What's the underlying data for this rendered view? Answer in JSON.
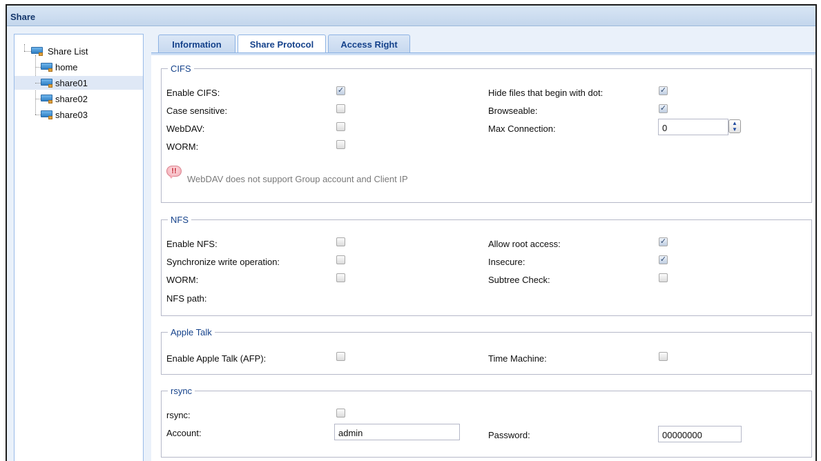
{
  "window": {
    "title": "Share"
  },
  "tree": {
    "root_label": "Share List",
    "items": [
      {
        "label": "home",
        "selected": false
      },
      {
        "label": "share01",
        "selected": true
      },
      {
        "label": "share02",
        "selected": false
      },
      {
        "label": "share03",
        "selected": false
      }
    ]
  },
  "tabs": [
    {
      "label": "Information",
      "active": false
    },
    {
      "label": "Share Protocol",
      "active": true
    },
    {
      "label": "Access Right",
      "active": false
    }
  ],
  "cifs": {
    "legend": "CIFS",
    "enable_cifs": {
      "label": "Enable CIFS:",
      "checked": true
    },
    "case_sensitive": {
      "label": "Case sensitive:",
      "checked": false
    },
    "webdav": {
      "label": "WebDAV:",
      "checked": false
    },
    "worm": {
      "label": "WORM:",
      "checked": false
    },
    "hide_dot": {
      "label": "Hide files that begin with dot:",
      "checked": true
    },
    "browseable": {
      "label": "Browseable:",
      "checked": true
    },
    "max_connection": {
      "label": "Max Connection:",
      "value": "0"
    },
    "note": "WebDAV does not support Group account and Client IP",
    "warn_icon_glyph": "!!"
  },
  "nfs": {
    "legend": "NFS",
    "enable_nfs": {
      "label": "Enable NFS:",
      "checked": false
    },
    "sync_write": {
      "label": "Synchronize write operation:",
      "checked": false
    },
    "worm": {
      "label": "WORM:",
      "checked": false
    },
    "nfs_path": {
      "label": "NFS path:"
    },
    "allow_root": {
      "label": "Allow root access:",
      "checked": true
    },
    "insecure": {
      "label": "Insecure:",
      "checked": true
    },
    "subtree_check": {
      "label": "Subtree Check:",
      "checked": false
    }
  },
  "appletalk": {
    "legend": "Apple Talk",
    "enable_afp": {
      "label": "Enable Apple Talk (AFP):",
      "checked": false
    },
    "time_machine": {
      "label": "Time Machine:",
      "checked": false
    }
  },
  "rsync": {
    "legend": "rsync",
    "rsync": {
      "label": "rsync:",
      "checked": false
    },
    "account": {
      "label": "Account:",
      "value": "admin"
    },
    "password": {
      "label": "Password:",
      "value": "00000000"
    }
  },
  "glyphs": {
    "check": "✓",
    "spin_up": "▲",
    "spin_down": "▼"
  },
  "colors": {
    "accent": "#15428b",
    "titlebar": "#c3d6ec",
    "selection": "#dfe8f6"
  }
}
